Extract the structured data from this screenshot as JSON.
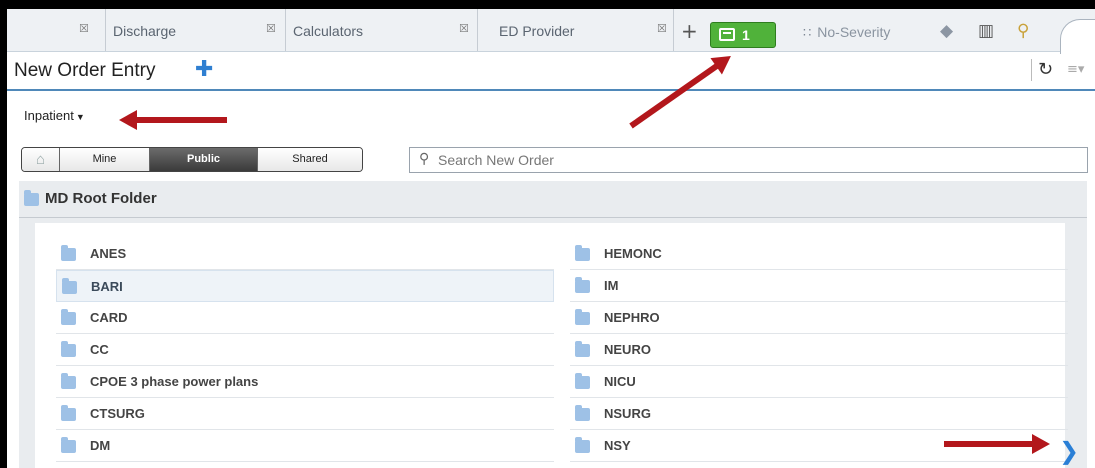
{
  "tabs": [
    {
      "label": "Discharge"
    },
    {
      "label": "Calculators"
    },
    {
      "label": "ED Provider"
    }
  ],
  "toolbar": {
    "add_tab_icon": "plus-icon",
    "message_count": "1",
    "severity_label": "No-Severity",
    "tag_icon": "tag-icon",
    "exit_icon": "door-exit-icon",
    "search_icon": "search-icon"
  },
  "header": {
    "title": "New Order Entry",
    "add_icon": "plus-icon",
    "refresh_icon": "refresh-icon",
    "menu_icon": "menu-icon"
  },
  "context": {
    "label": "Inpatient"
  },
  "filters": {
    "home_icon": "home-icon",
    "mine": "Mine",
    "public": "Public",
    "shared": "Shared",
    "selected": "Public"
  },
  "search": {
    "placeholder": "Search New Order",
    "value": ""
  },
  "root_folder": {
    "label": "MD Root Folder"
  },
  "folders": {
    "left": [
      {
        "label": "ANES"
      },
      {
        "label": "BARI"
      },
      {
        "label": "CARD"
      },
      {
        "label": "CC"
      },
      {
        "label": "CPOE 3 phase power plans"
      },
      {
        "label": "CTSURG"
      },
      {
        "label": "DM"
      }
    ],
    "right": [
      {
        "label": "HEMONC"
      },
      {
        "label": "IM"
      },
      {
        "label": "NEPHRO"
      },
      {
        "label": "NEURO"
      },
      {
        "label": "NICU"
      },
      {
        "label": "NSURG"
      },
      {
        "label": "NSY"
      }
    ],
    "selected": "BARI"
  },
  "colors": {
    "accent": "#2f7fd1",
    "green_button": "#50b23a",
    "annotation_arrow": "#b3171c"
  }
}
